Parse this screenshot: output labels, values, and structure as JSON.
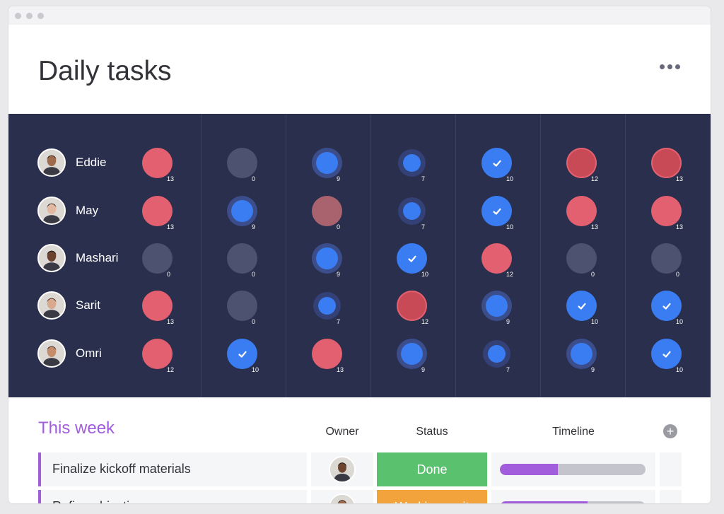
{
  "page": {
    "title": "Daily tasks"
  },
  "heatmap": {
    "people": [
      {
        "name": "Eddie",
        "avatar_skin": "#a06a4c",
        "avatar_hair": "#2a1d17"
      },
      {
        "name": "May",
        "avatar_skin": "#e3b8a0",
        "avatar_hair": "#2e2520"
      },
      {
        "name": "Mashari",
        "avatar_skin": "#6b432f",
        "avatar_hair": "#1b1411"
      },
      {
        "name": "Sarit",
        "avatar_skin": "#d8a98e",
        "avatar_hair": "#3a2a22"
      },
      {
        "name": "Omri",
        "avatar_skin": "#c58d6c",
        "avatar_hair": "#3b2a20"
      }
    ],
    "rows": [
      [
        {
          "v": "13",
          "s": "red"
        },
        {
          "v": "0",
          "s": "gray"
        },
        {
          "v": "9",
          "s": "blue-ring"
        },
        {
          "v": "7",
          "s": "blue-small"
        },
        {
          "v": "10",
          "s": "blue-check"
        },
        {
          "v": "12",
          "s": "dark-red"
        },
        {
          "v": "13",
          "s": "dark-red"
        }
      ],
      [
        {
          "v": "13",
          "s": "red"
        },
        {
          "v": "9",
          "s": "blue-ring"
        },
        {
          "v": "0",
          "s": "muted-red"
        },
        {
          "v": "7",
          "s": "blue-small"
        },
        {
          "v": "10",
          "s": "blue-check"
        },
        {
          "v": "13",
          "s": "red"
        },
        {
          "v": "13",
          "s": "red"
        }
      ],
      [
        {
          "v": "0",
          "s": "gray"
        },
        {
          "v": "0",
          "s": "gray"
        },
        {
          "v": "9",
          "s": "blue-ring"
        },
        {
          "v": "10",
          "s": "blue-check"
        },
        {
          "v": "12",
          "s": "red"
        },
        {
          "v": "0",
          "s": "gray"
        },
        {
          "v": "0",
          "s": "gray"
        }
      ],
      [
        {
          "v": "13",
          "s": "red"
        },
        {
          "v": "0",
          "s": "gray"
        },
        {
          "v": "7",
          "s": "blue-small"
        },
        {
          "v": "12",
          "s": "dark-red"
        },
        {
          "v": "9",
          "s": "blue-ring"
        },
        {
          "v": "10",
          "s": "blue-check"
        },
        {
          "v": "10",
          "s": "blue-check"
        }
      ],
      [
        {
          "v": "12",
          "s": "red"
        },
        {
          "v": "10",
          "s": "blue-check"
        },
        {
          "v": "13",
          "s": "red"
        },
        {
          "v": "9",
          "s": "blue-ring"
        },
        {
          "v": "7",
          "s": "blue-small"
        },
        {
          "v": "9",
          "s": "blue-ring"
        },
        {
          "v": "10",
          "s": "blue-check"
        }
      ]
    ]
  },
  "board": {
    "group_title": "This week",
    "columns": {
      "owner": "Owner",
      "status": "Status",
      "timeline": "Timeline"
    },
    "rows": [
      {
        "task": "Finalize kickoff materials",
        "status": "Done",
        "status_color": "#5ac26e",
        "progress": 0.4
      },
      {
        "task": "Refine objectives",
        "status": "Working on it",
        "status_color": "#f2a33c",
        "progress": 0.6
      }
    ]
  },
  "colors": {
    "accent": "#a25ddc",
    "heatmap_bg": "#292f4c",
    "red": "#e2606f",
    "blue": "#3a7cf2"
  }
}
